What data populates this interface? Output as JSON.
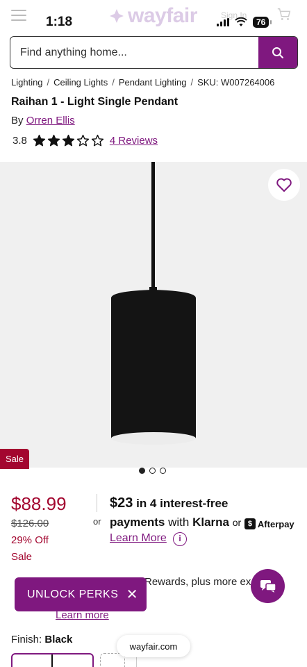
{
  "status_bar": {
    "time": "1:18",
    "battery": "76",
    "signin_label": "Sign In",
    "logo_text": "wayfair"
  },
  "search": {
    "placeholder": "Find anything home..."
  },
  "breadcrumb": {
    "items": [
      "Lighting",
      "Ceiling Lights",
      "Pendant Lighting"
    ],
    "sku": "SKU: W007264006"
  },
  "product": {
    "title": "Raihan 1 - Light Single Pendant",
    "by_prefix": "By",
    "brand": "Orren Ellis",
    "rating_value": "3.8",
    "rating_stars": 3.8,
    "reviews_label": "4 Reviews",
    "sale_tag": "Sale",
    "image_count": 3,
    "active_image": 1
  },
  "pricing": {
    "price": "$88.99",
    "original_price": "$126.00",
    "percent_off": "29% Off",
    "sale_label": "Sale",
    "or_label": "or"
  },
  "financing": {
    "amount": "$23",
    "text1": " in 4 interest-free",
    "text2": "payments",
    "with_label": "with",
    "klarna": "Klarna",
    "or_label": "or",
    "afterpay": "Afterpay",
    "learn_more": "Learn More"
  },
  "rewards": {
    "text": "Rewards, plus more ex",
    "learn_more": "Learn more"
  },
  "unlock_banner": {
    "label": "UNLOCK PERKS",
    "close_icon": "close-icon"
  },
  "finish": {
    "label": "Finish:",
    "value": "Black"
  },
  "browser": {
    "url": "wayfair.com"
  },
  "colors": {
    "brand_purple": "#7f187f",
    "sale_red": "#a3062f"
  }
}
